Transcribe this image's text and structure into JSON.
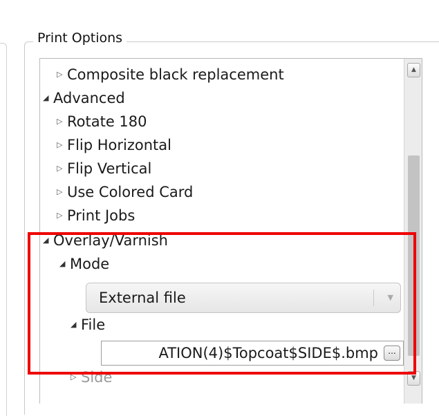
{
  "group_title": "Print Options",
  "tree": {
    "composite": "Composite black replacement",
    "advanced": "Advanced",
    "rotate": "Rotate 180",
    "flip_h": "Flip Horizontal",
    "flip_v": "Flip Vertical",
    "colored_card": "Use Colored Card",
    "print_jobs": "Print Jobs",
    "overlay": "Overlay/Varnish",
    "mode": "Mode",
    "mode_value": "External file",
    "file": "File",
    "file_value": "ATION(4)$Topcoat$SIDE$.bmp",
    "browse": "...",
    "side": "Side"
  },
  "icons": {
    "collapsed": "triangle-right-icon",
    "expanded": "triangle-down-icon"
  },
  "colors": {
    "highlight": "#ee0000",
    "scroll_thumb": "#c3c3c3"
  }
}
